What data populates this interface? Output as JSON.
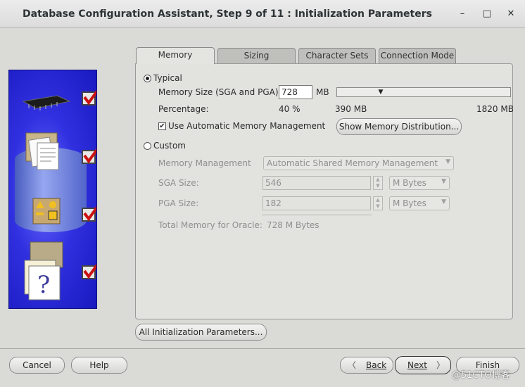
{
  "window": {
    "title": "Database Configuration Assistant, Step 9 of 11 : Initialization Parameters",
    "minimize": "–",
    "maximize": "□",
    "close": "✕"
  },
  "tabs": [
    "Memory",
    "Sizing",
    "Character Sets",
    "Connection Mode"
  ],
  "memory": {
    "typical_label": "Typical",
    "memory_size_label": "Memory Size (SGA and PGA):",
    "memory_size_value": "728",
    "memory_size_unit": "MB",
    "percentage_label": "Percentage:",
    "percentage_value": "40 %",
    "slider_min": "390 MB",
    "slider_max": "1820 MB",
    "slider_level": 0.237,
    "use_amm_label": "Use Automatic Memory Management",
    "use_amm_checked": true,
    "show_distribution_button": "Show Memory Distribution...",
    "custom_label": "Custom",
    "memory_management_label": "Memory Management",
    "memory_management_value": "Automatic Shared Memory Management",
    "sga_size_label": "SGA Size:",
    "sga_size_value": "546",
    "sga_unit": "M Bytes",
    "pga_size_label": "PGA Size:",
    "pga_size_value": "182",
    "pga_unit": "M Bytes",
    "total_memory_label": "Total Memory for Oracle:",
    "total_memory_value": "728 M Bytes"
  },
  "all_params_button": "All Initialization Parameters...",
  "footer": {
    "cancel": "Cancel",
    "help": "Help",
    "back": "Back",
    "next": "Next",
    "finish": "Finish"
  },
  "watermark": "@51CTO博客",
  "colors": {
    "accent_blue": "#2a2ad8",
    "check_red": "#cc1111"
  }
}
